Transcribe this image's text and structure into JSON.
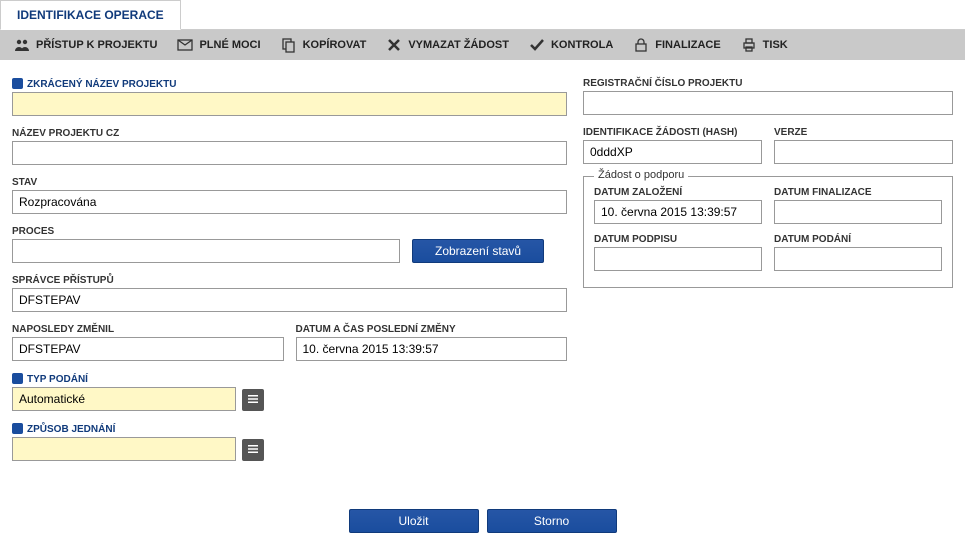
{
  "tab": {
    "label": "IDENTIFIKACE OPERACE"
  },
  "toolbar": {
    "access": "PŘÍSTUP K PROJEKTU",
    "powers": "PLNÉ MOCI",
    "copy": "KOPÍROVAT",
    "delete": "VYMAZAT ŽÁDOST",
    "check": "KONTROLA",
    "finalize": "FINALIZACE",
    "print": "TISK"
  },
  "left": {
    "short_name_label": "ZKRÁCENÝ NÁZEV PROJEKTU",
    "short_name": "",
    "name_cz_label": "NÁZEV PROJEKTU CZ",
    "name_cz": "",
    "stav_label": "STAV",
    "stav": "Rozpracována",
    "proces_label": "PROCES",
    "proces": "",
    "show_states_btn": "Zobrazení stavů",
    "admin_label": "SPRÁVCE PŘÍSTUPŮ",
    "admin": "DFSTEPAV",
    "last_changed_by_label": "NAPOSLEDY ZMĚNIL",
    "last_changed_by": "DFSTEPAV",
    "last_change_dt_label": "DATUM A ČAS POSLEDNÍ ZMĚNY",
    "last_change_dt": "10. června 2015 13:39:57",
    "typ_podani_label": "TYP PODÁNÍ",
    "typ_podani": "Automatické",
    "zpusob_jednani_label": "ZPŮSOB JEDNÁNÍ",
    "zpusob_jednani": ""
  },
  "right": {
    "reg_num_label": "REGISTRAČNÍ ČÍSLO PROJEKTU",
    "reg_num": "",
    "hash_label": "IDENTIFIKACE ŽÁDOSTI (HASH)",
    "hash": "0dddXP",
    "verze_label": "VERZE",
    "verze": "",
    "fieldset_title": "Žádost o podporu",
    "datum_zalozeni_label": "DATUM ZALOŽENÍ",
    "datum_zalozeni": "10. června 2015 13:39:57",
    "datum_finalizace_label": "DATUM FINALIZACE",
    "datum_finalizace": "",
    "datum_podpisu_label": "DATUM PODPISU",
    "datum_podpisu": "",
    "datum_podani_label": "DATUM PODÁNÍ",
    "datum_podani": ""
  },
  "footer": {
    "save": "Uložit",
    "cancel": "Storno"
  }
}
